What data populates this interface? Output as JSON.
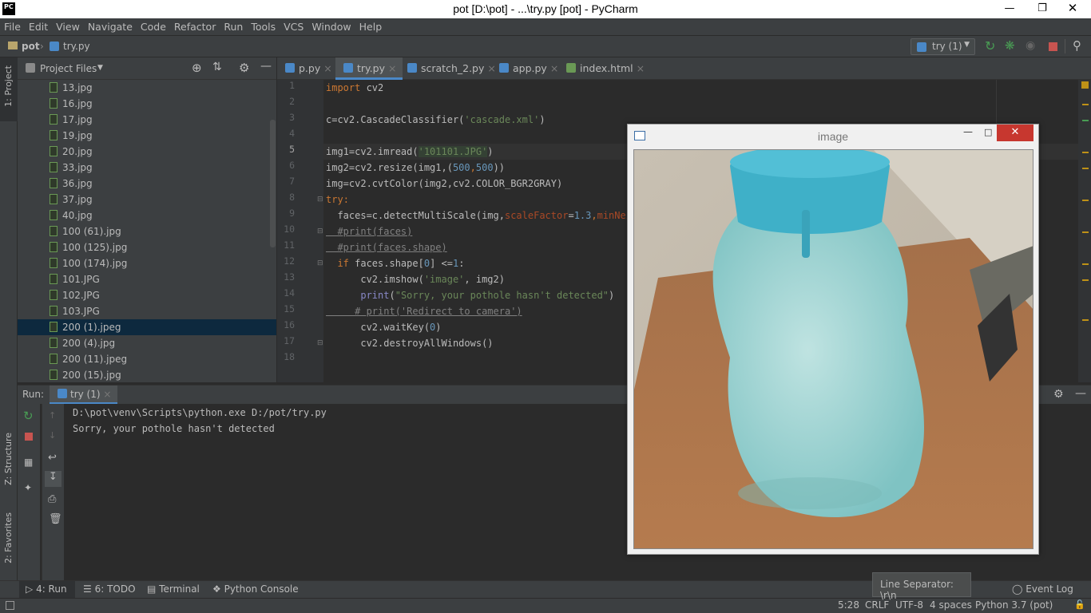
{
  "window": {
    "title": "pot [D:\\pot] - ...\\try.py [pot] - PyCharm",
    "logo": "PC"
  },
  "menu": [
    "File",
    "Edit",
    "View",
    "Navigate",
    "Code",
    "Refactor",
    "Run",
    "Tools",
    "VCS",
    "Window",
    "Help"
  ],
  "breadcrumb": {
    "project": "pot",
    "file": "try.py"
  },
  "run_config": {
    "label": "try (1)"
  },
  "project_panel": {
    "title": "Project Files",
    "files": [
      "13.jpg",
      "16.jpg",
      "17.jpg",
      "19.jpg",
      "20.jpg",
      "33.jpg",
      "36.jpg",
      "37.jpg",
      "40.jpg",
      "100 (61).jpg",
      "100 (125).jpg",
      "100 (174).jpg",
      "101.JPG",
      "102.JPG",
      "103.JPG",
      "200 (1).jpeg",
      "200 (4).jpg",
      "200 (11).jpeg",
      "200 (15).jpg"
    ],
    "selected": "200 (1).jpeg"
  },
  "left_stripe": {
    "project": "1: Project",
    "structure": "Z: Structure",
    "favorites": "2: Favorites"
  },
  "tabs": [
    "p.py",
    "try.py",
    "scratch_2.py",
    "app.py",
    "index.html"
  ],
  "active_tab": "try.py",
  "code_lines": [
    "1",
    "2",
    "3",
    "4",
    "5",
    "6",
    "7",
    "8",
    "9",
    "10",
    "11",
    "12",
    "13",
    "14",
    "15",
    "16",
    "17",
    "18"
  ],
  "code": {
    "l1a": "import",
    "l1b": " cv2",
    "l3a": "c=cv2.CascadeClassifier(",
    "l3b": "'cascade.xml'",
    "l3c": ")",
    "l5a": "img1=cv2.imread(",
    "l5b": "'101101.JPG'",
    "l5c": ")",
    "l6a": "img2=cv2.resize(img1,(",
    "l6b": "500",
    "l6c": ",",
    "l6d": "500",
    "l6e": "))",
    "l7": "img=cv2.cvtColor(img2,cv2.COLOR_BGR2GRAY)",
    "l8a": "try",
    "l8b": ":",
    "l9a": "  faces=c.detectMultiScale(img,",
    "l9b": "scaleFactor",
    "l9c": "=",
    "l9d": "1.3",
    "l9e": ",",
    "l9f": "minNeig",
    "l10": "  #print(faces)",
    "l11": "  #print(faces.shape)",
    "l12a": "  ",
    "l12b": "if",
    "l12c": " faces.shape[",
    "l12d": "0",
    "l12e": "] <=",
    "l12f": "1",
    "l12g": ":",
    "l13a": "      cv2.imshow(",
    "l13b": "'image'",
    "l13c": ", img2)",
    "l14a": "      ",
    "l14b": "print",
    "l14c": "(",
    "l14d": "\"Sorry, your pothole hasn't detected\"",
    "l14e": ")",
    "l15": "     # print('Redirect to camera')",
    "l16a": "      cv2.waitKey(",
    "l16b": "0",
    "l16c": ")",
    "l17": "      cv2.destroyAllWindows()"
  },
  "run_panel": {
    "label": "Run:",
    "tab": "try (1)",
    "output": [
      "D:\\pot\\venv\\Scripts\\python.exe D:/pot/try.py",
      "Sorry, your pothole hasn't detected"
    ]
  },
  "image_window": {
    "title": "image"
  },
  "bottom_tabs": {
    "run": "4: Run",
    "todo": "6: TODO",
    "terminal": "Terminal",
    "console": "Python Console",
    "event_log": "Event Log"
  },
  "tooltip": "Line Separator: \\r\\n",
  "status": {
    "position": "5:28",
    "line_sep": "CRLF",
    "encoding": "UTF-8",
    "indent": "4 spaces",
    "interpreter": "Python 3.7 (pot)"
  },
  "colors": {
    "keyword": "#cc7832",
    "string": "#6a8759",
    "number": "#6897bb",
    "comment": "#808080",
    "selection": "#0d293e",
    "accent": "#4a88c7"
  }
}
